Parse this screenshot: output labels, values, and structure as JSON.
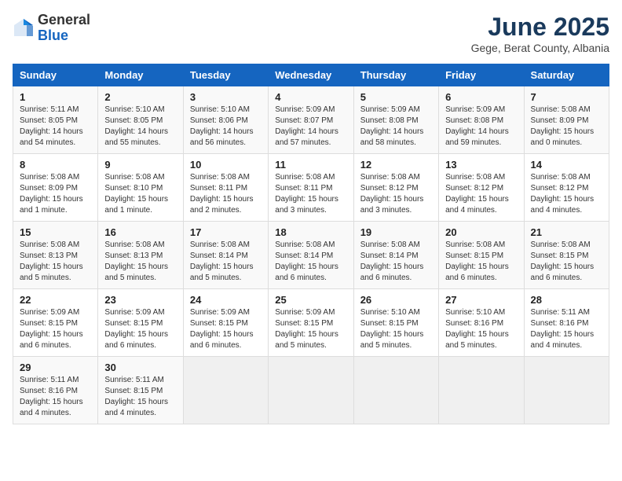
{
  "logo": {
    "general": "General",
    "blue": "Blue"
  },
  "header": {
    "month": "June 2025",
    "location": "Gege, Berat County, Albania"
  },
  "days_of_week": [
    "Sunday",
    "Monday",
    "Tuesday",
    "Wednesday",
    "Thursday",
    "Friday",
    "Saturday"
  ],
  "weeks": [
    [
      {
        "day": "1",
        "info": "Sunrise: 5:11 AM\nSunset: 8:05 PM\nDaylight: 14 hours\nand 54 minutes."
      },
      {
        "day": "2",
        "info": "Sunrise: 5:10 AM\nSunset: 8:05 PM\nDaylight: 14 hours\nand 55 minutes."
      },
      {
        "day": "3",
        "info": "Sunrise: 5:10 AM\nSunset: 8:06 PM\nDaylight: 14 hours\nand 56 minutes."
      },
      {
        "day": "4",
        "info": "Sunrise: 5:09 AM\nSunset: 8:07 PM\nDaylight: 14 hours\nand 57 minutes."
      },
      {
        "day": "5",
        "info": "Sunrise: 5:09 AM\nSunset: 8:08 PM\nDaylight: 14 hours\nand 58 minutes."
      },
      {
        "day": "6",
        "info": "Sunrise: 5:09 AM\nSunset: 8:08 PM\nDaylight: 14 hours\nand 59 minutes."
      },
      {
        "day": "7",
        "info": "Sunrise: 5:08 AM\nSunset: 8:09 PM\nDaylight: 15 hours\nand 0 minutes."
      }
    ],
    [
      {
        "day": "8",
        "info": "Sunrise: 5:08 AM\nSunset: 8:09 PM\nDaylight: 15 hours\nand 1 minute."
      },
      {
        "day": "9",
        "info": "Sunrise: 5:08 AM\nSunset: 8:10 PM\nDaylight: 15 hours\nand 1 minute."
      },
      {
        "day": "10",
        "info": "Sunrise: 5:08 AM\nSunset: 8:11 PM\nDaylight: 15 hours\nand 2 minutes."
      },
      {
        "day": "11",
        "info": "Sunrise: 5:08 AM\nSunset: 8:11 PM\nDaylight: 15 hours\nand 3 minutes."
      },
      {
        "day": "12",
        "info": "Sunrise: 5:08 AM\nSunset: 8:12 PM\nDaylight: 15 hours\nand 3 minutes."
      },
      {
        "day": "13",
        "info": "Sunrise: 5:08 AM\nSunset: 8:12 PM\nDaylight: 15 hours\nand 4 minutes."
      },
      {
        "day": "14",
        "info": "Sunrise: 5:08 AM\nSunset: 8:12 PM\nDaylight: 15 hours\nand 4 minutes."
      }
    ],
    [
      {
        "day": "15",
        "info": "Sunrise: 5:08 AM\nSunset: 8:13 PM\nDaylight: 15 hours\nand 5 minutes."
      },
      {
        "day": "16",
        "info": "Sunrise: 5:08 AM\nSunset: 8:13 PM\nDaylight: 15 hours\nand 5 minutes."
      },
      {
        "day": "17",
        "info": "Sunrise: 5:08 AM\nSunset: 8:14 PM\nDaylight: 15 hours\nand 5 minutes."
      },
      {
        "day": "18",
        "info": "Sunrise: 5:08 AM\nSunset: 8:14 PM\nDaylight: 15 hours\nand 6 minutes."
      },
      {
        "day": "19",
        "info": "Sunrise: 5:08 AM\nSunset: 8:14 PM\nDaylight: 15 hours\nand 6 minutes."
      },
      {
        "day": "20",
        "info": "Sunrise: 5:08 AM\nSunset: 8:15 PM\nDaylight: 15 hours\nand 6 minutes."
      },
      {
        "day": "21",
        "info": "Sunrise: 5:08 AM\nSunset: 8:15 PM\nDaylight: 15 hours\nand 6 minutes."
      }
    ],
    [
      {
        "day": "22",
        "info": "Sunrise: 5:09 AM\nSunset: 8:15 PM\nDaylight: 15 hours\nand 6 minutes."
      },
      {
        "day": "23",
        "info": "Sunrise: 5:09 AM\nSunset: 8:15 PM\nDaylight: 15 hours\nand 6 minutes."
      },
      {
        "day": "24",
        "info": "Sunrise: 5:09 AM\nSunset: 8:15 PM\nDaylight: 15 hours\nand 6 minutes."
      },
      {
        "day": "25",
        "info": "Sunrise: 5:09 AM\nSunset: 8:15 PM\nDaylight: 15 hours\nand 5 minutes."
      },
      {
        "day": "26",
        "info": "Sunrise: 5:10 AM\nSunset: 8:15 PM\nDaylight: 15 hours\nand 5 minutes."
      },
      {
        "day": "27",
        "info": "Sunrise: 5:10 AM\nSunset: 8:16 PM\nDaylight: 15 hours\nand 5 minutes."
      },
      {
        "day": "28",
        "info": "Sunrise: 5:11 AM\nSunset: 8:16 PM\nDaylight: 15 hours\nand 4 minutes."
      }
    ],
    [
      {
        "day": "29",
        "info": "Sunrise: 5:11 AM\nSunset: 8:16 PM\nDaylight: 15 hours\nand 4 minutes."
      },
      {
        "day": "30",
        "info": "Sunrise: 5:11 AM\nSunset: 8:15 PM\nDaylight: 15 hours\nand 4 minutes."
      },
      {
        "day": "",
        "info": ""
      },
      {
        "day": "",
        "info": ""
      },
      {
        "day": "",
        "info": ""
      },
      {
        "day": "",
        "info": ""
      },
      {
        "day": "",
        "info": ""
      }
    ]
  ]
}
